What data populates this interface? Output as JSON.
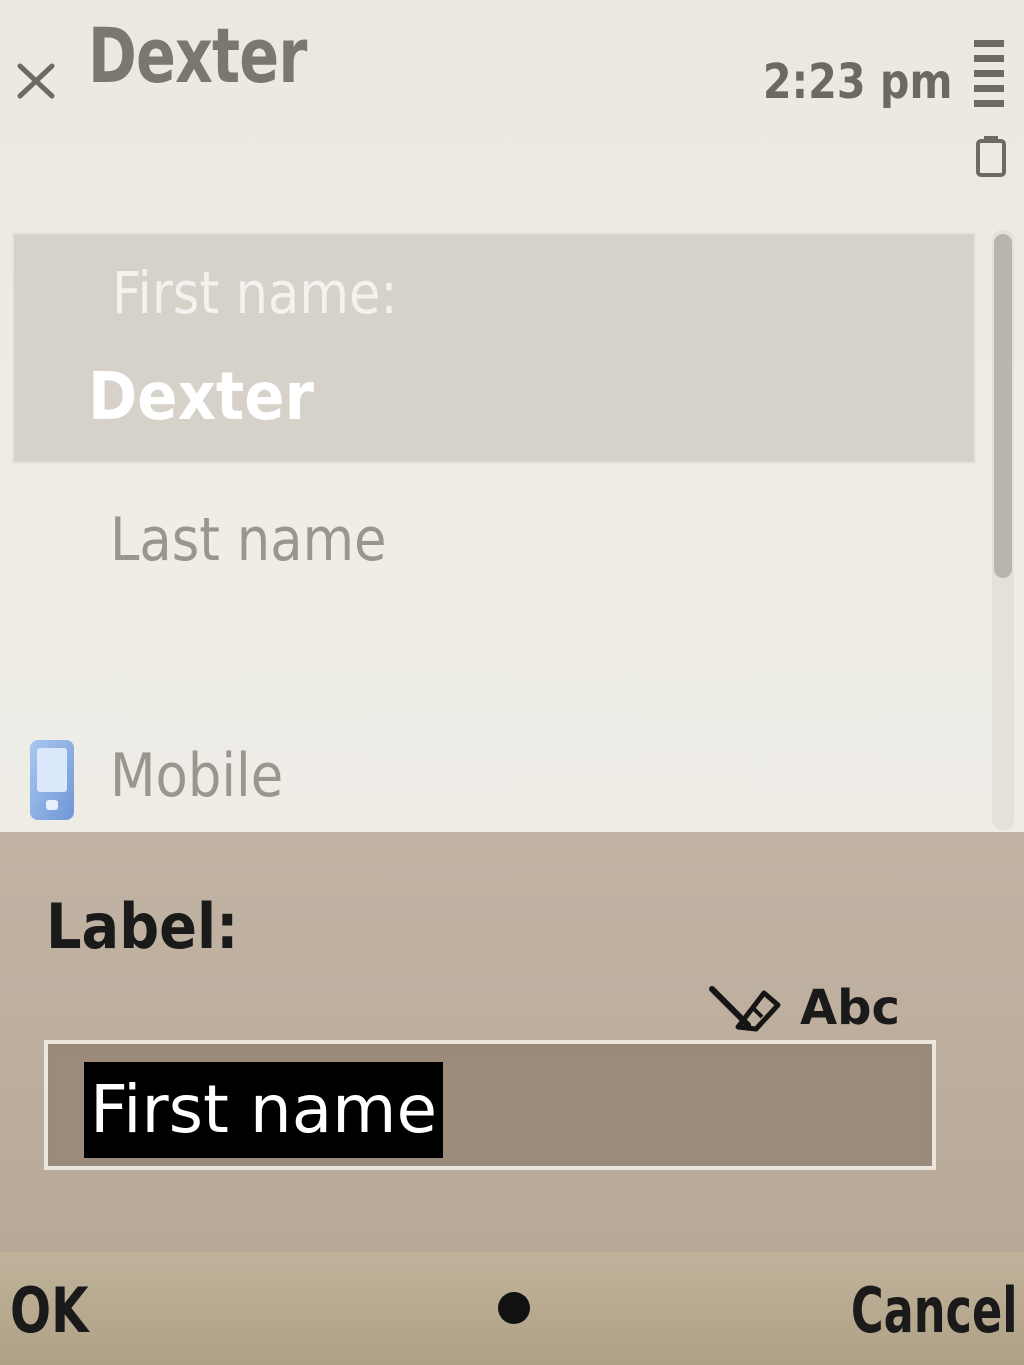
{
  "header": {
    "title": "Dexter",
    "time": "2:23 pm"
  },
  "list": {
    "selected_item": {
      "label": "First name:",
      "value": "Dexter"
    },
    "items": [
      {
        "label": "Last name",
        "icon": null
      },
      {
        "label": "Mobile",
        "icon": "mobile-phone-icon"
      }
    ]
  },
  "dialog": {
    "label": "Label:",
    "input_mode": "Abc",
    "input_mode_icon": "pen-input-icon",
    "field_value": "First name"
  },
  "softkeys": {
    "left": "OK",
    "right": "Cancel"
  },
  "colors": {
    "dialog_bg": "#c2b4a4",
    "selection_bg": "#000000",
    "selected_row": "#d6d1c9"
  }
}
